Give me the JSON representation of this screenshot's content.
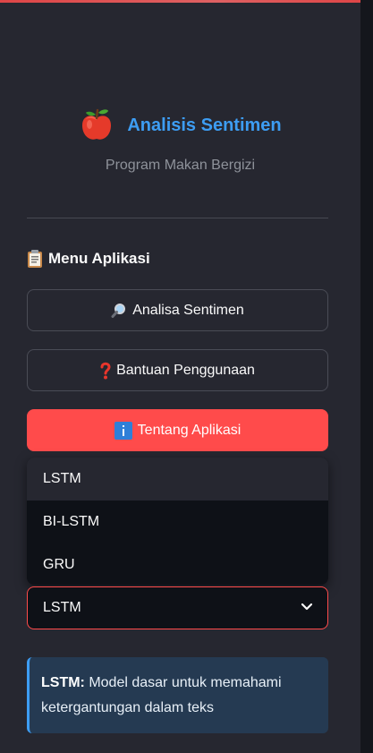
{
  "brand": {
    "title": "Analisis Sentimen",
    "subtitle": "Program Makan Bergizi",
    "icon": "apple-icon"
  },
  "menu": {
    "heading": "Menu Aplikasi",
    "heading_icon": "clipboard-icon",
    "buttons": [
      {
        "label": "Analisa Sentimen",
        "icon": "magnifier-icon"
      },
      {
        "label": "Bantuan Penggunaan",
        "icon": "question-icon"
      },
      {
        "label": "Tentang Aplikasi",
        "icon": "info-icon",
        "active": true
      }
    ]
  },
  "model_select": {
    "options": [
      "LSTM",
      "BI-LSTM",
      "GRU"
    ],
    "highlighted_option": "LSTM",
    "selected": "LSTM"
  },
  "info": {
    "term": "LSTM:",
    "description": "Model dasar untuk memahami ketergantungan dalam teks"
  },
  "colors": {
    "accent": "#ff4b4b",
    "brand_blue": "#3d9df3",
    "sidebar_bg": "#262730",
    "info_bg": "#253a52"
  }
}
